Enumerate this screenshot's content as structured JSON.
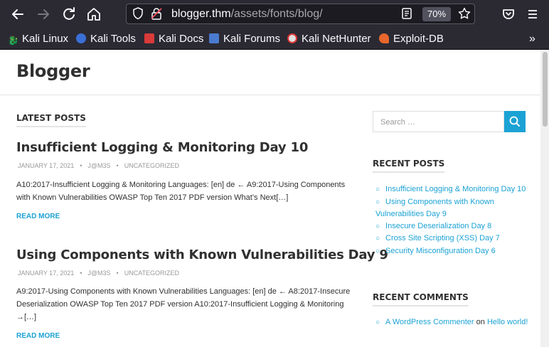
{
  "browser": {
    "url_host": "blogger.thm",
    "url_path": "/assets/fonts/blog/",
    "zoom": "70%",
    "bookmarks": [
      {
        "label": "Kali Linux",
        "icon": "kali-dragon-icon"
      },
      {
        "label": "Kali Tools",
        "icon": "kali-tools-icon"
      },
      {
        "label": "Kali Docs",
        "icon": "kali-docs-icon"
      },
      {
        "label": "Kali Forums",
        "icon": "kali-forums-icon"
      },
      {
        "label": "Kali NetHunter",
        "icon": "kali-nethunter-icon"
      },
      {
        "label": "Exploit-DB",
        "icon": "exploit-db-icon"
      }
    ],
    "colors": {
      "chrome": "#2b2a33",
      "url_bg": "#1c1b22",
      "accent": "#1ba2d4"
    }
  },
  "site": {
    "title": "Blogger",
    "latest_label": "LATEST POSTS",
    "posts": [
      {
        "title": "Insufficient Logging & Monitoring Day 10",
        "date": "JANUARY 17, 2021",
        "author": "J@M3S",
        "category": "UNCATEGORIZED",
        "excerpt": "A10:2017-Insufficient Logging & Monitoring Languages: [en] de ← A9:2017-Using Components with Known Vulnerabilities OWASP Top Ten 2017 PDF version What’s Next[…]",
        "read_more": "READ MORE"
      },
      {
        "title": "Using Components with Known Vulnerabilities Day 9",
        "date": "JANUARY 17, 2021",
        "author": "J@M3S",
        "category": "UNCATEGORIZED",
        "excerpt": "A9:2017-Using Components with Known Vulnerabilities Languages: [en] de ← A8:2017-Insecure Deserialization OWASP Top Ten 2017 PDF version A10:2017-Insufficient Logging & Monitoring →[…]",
        "read_more": "READ MORE"
      }
    ]
  },
  "sidebar": {
    "search_placeholder": "Search …",
    "recent_posts_label": "RECENT POSTS",
    "recent_posts": [
      "Insufficient Logging & Monitoring Day 10",
      "Using Components with Known Vulnerabilities Day 9",
      "Insecure Deserialization Day 8",
      "Cross Site Scripting (XSS) Day 7",
      "Security Misconfiguration Day 6"
    ],
    "recent_comments_label": "RECENT COMMENTS",
    "comment": {
      "author": "A WordPress Commenter",
      "on": "on",
      "post": "Hello world!"
    }
  }
}
